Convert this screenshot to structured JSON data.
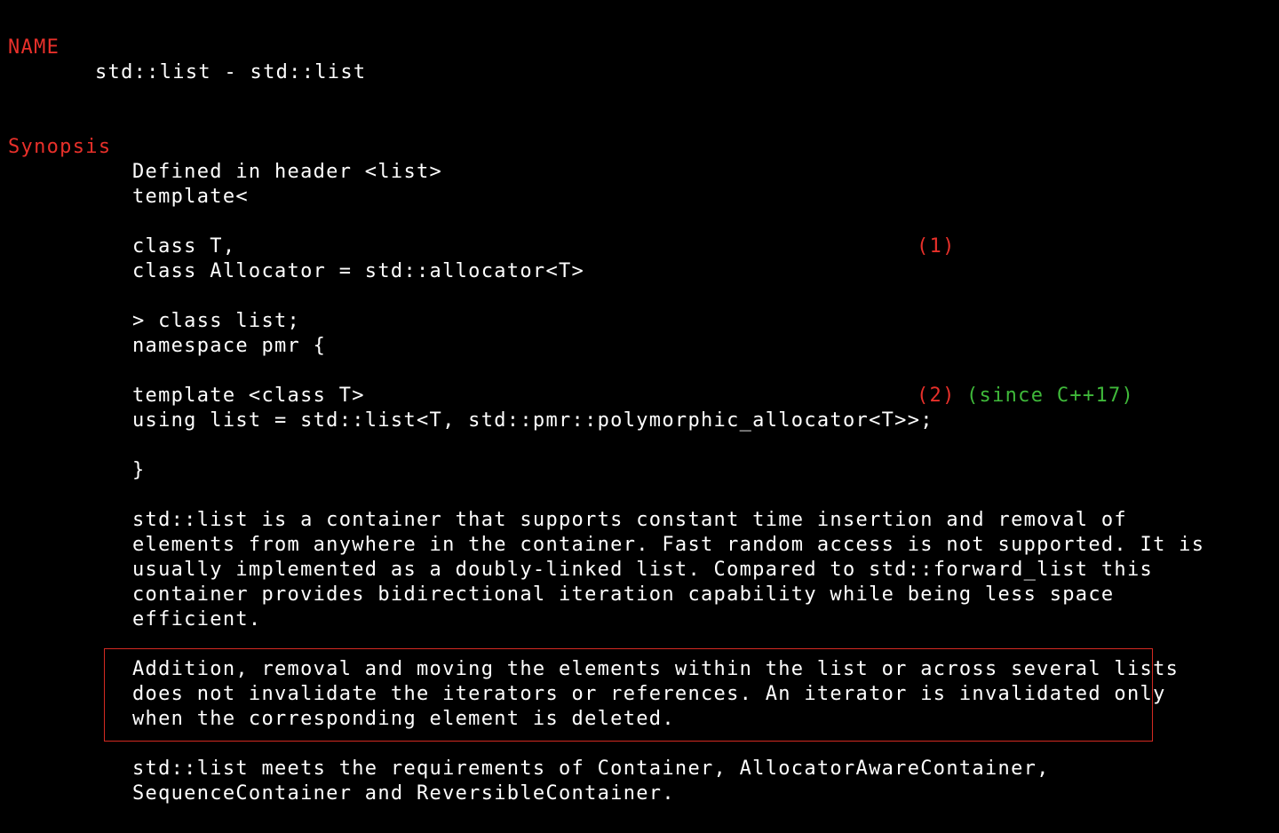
{
  "sections": {
    "name_heading": "NAME",
    "name_line": "std::list - std::list",
    "synopsis_heading": "Synopsis"
  },
  "synopsis": {
    "defined_in": "Defined in header <list>",
    "template_open": "template<",
    "class_t": "class T,",
    "class_allocator": "class Allocator = std::allocator<T>",
    "class_list": "> class list;",
    "namespace_pmr": "namespace pmr {",
    "template_class_t": "template <class T>",
    "using_list": "using list = std::list<T, std::pmr::polymorphic_allocator<T>>;",
    "close_brace": "}",
    "marker_1": "(1)",
    "marker_2": "(2)",
    "since": "(since C++17)"
  },
  "description": {
    "para1": [
      "std::list is a container that supports constant time insertion and removal of",
      "elements from anywhere in the container. Fast random access is not supported. It is",
      "usually implemented as a doubly-linked list. Compared to std::forward_list this",
      "container provides bidirectional iteration capability while being less space",
      "efficient."
    ],
    "para2": [
      "Addition, removal and moving the elements within the list or across several lists",
      "does not invalidate the iterators or references. An iterator is invalidated only",
      "when the corresponding element is deleted."
    ],
    "para3": [
      "std::list meets the requirements of Container, AllocatorAwareContainer,",
      "SequenceContainer and ReversibleContainer."
    ]
  },
  "colors": {
    "background": "#000000",
    "text": "#ffffff",
    "heading": "#e8302a",
    "since": "#3fb93a",
    "highlight_border": "#d42a22"
  }
}
